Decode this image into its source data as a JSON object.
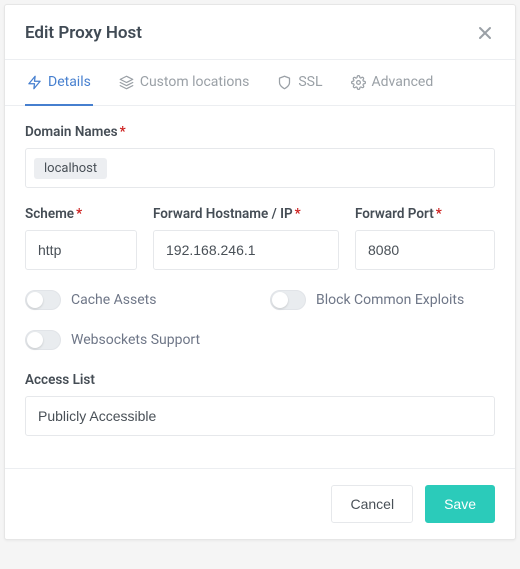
{
  "modal": {
    "title": "Edit Proxy Host"
  },
  "tabs": {
    "details": "Details",
    "custom": "Custom locations",
    "ssl": "SSL",
    "advanced": "Advanced"
  },
  "labels": {
    "domain_names": "Domain Names",
    "scheme": "Scheme",
    "hostname": "Forward Hostname / IP",
    "port": "Forward Port",
    "cache_assets": "Cache Assets",
    "block_exploits": "Block Common Exploits",
    "websockets": "Websockets Support",
    "access_list": "Access List"
  },
  "values": {
    "domain_tag": "localhost",
    "scheme": "http",
    "hostname": "192.168.246.1",
    "port": "8080",
    "access_list": "Publicly Accessible"
  },
  "toggles": {
    "cache_assets": false,
    "block_exploits": false,
    "websockets": false
  },
  "buttons": {
    "cancel": "Cancel",
    "save": "Save"
  }
}
